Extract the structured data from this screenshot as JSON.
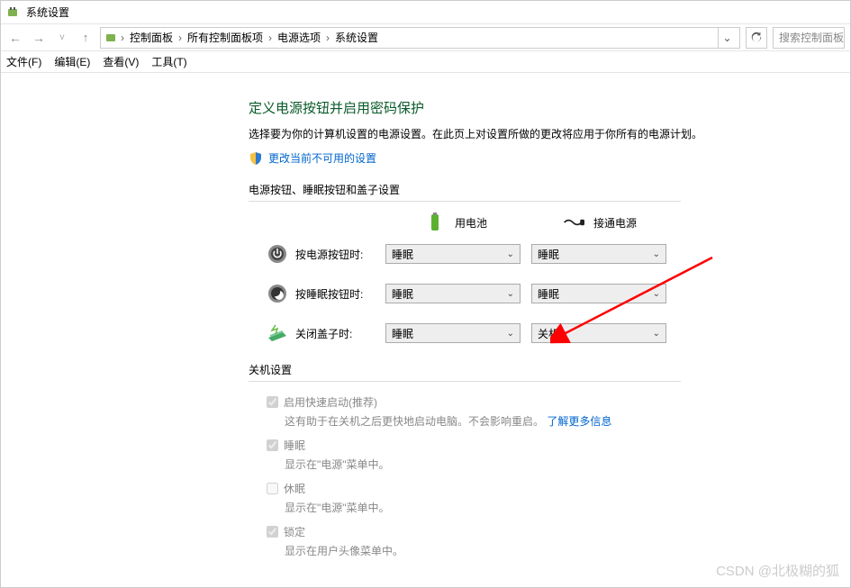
{
  "window": {
    "title": "系统设置"
  },
  "breadcrumb": {
    "items": [
      "控制面板",
      "所有控制面板项",
      "电源选项",
      "系统设置"
    ]
  },
  "search": {
    "placeholder": "搜索控制面板"
  },
  "menu": {
    "file": "文件(F)",
    "edit": "编辑(E)",
    "view": "查看(V)",
    "tools": "工具(T)"
  },
  "page": {
    "heading": "定义电源按钮并启用密码保护",
    "desc": "选择要为你的计算机设置的电源设置。在此页上对设置所做的更改将应用于你所有的电源计划。",
    "admin_link": "更改当前不可用的设置",
    "section1_title": "电源按钮、睡眠按钮和盖子设置",
    "col_battery": "用电池",
    "col_plugged": "接通电源",
    "rows": [
      {
        "label": "按电源按钮时:",
        "battery": "睡眠",
        "plugged": "睡眠"
      },
      {
        "label": "按睡眠按钮时:",
        "battery": "睡眠",
        "plugged": "睡眠"
      },
      {
        "label": "关闭盖子时:",
        "battery": "睡眠",
        "plugged": "关机"
      }
    ],
    "section2_title": "关机设置",
    "shutdown": {
      "fast": {
        "label": "启用快速启动(推荐)",
        "desc_a": "这有助于在关机之后更快地启动电脑。不会影响重启。",
        "link": "了解更多信息"
      },
      "sleep": {
        "label": "睡眠",
        "desc": "显示在\"电源\"菜单中。"
      },
      "hibernate": {
        "label": "休眠",
        "desc": "显示在\"电源\"菜单中。"
      },
      "lock": {
        "label": "锁定",
        "desc": "显示在用户头像菜单中。"
      }
    }
  },
  "watermark": "CSDN @北极糊的狐"
}
